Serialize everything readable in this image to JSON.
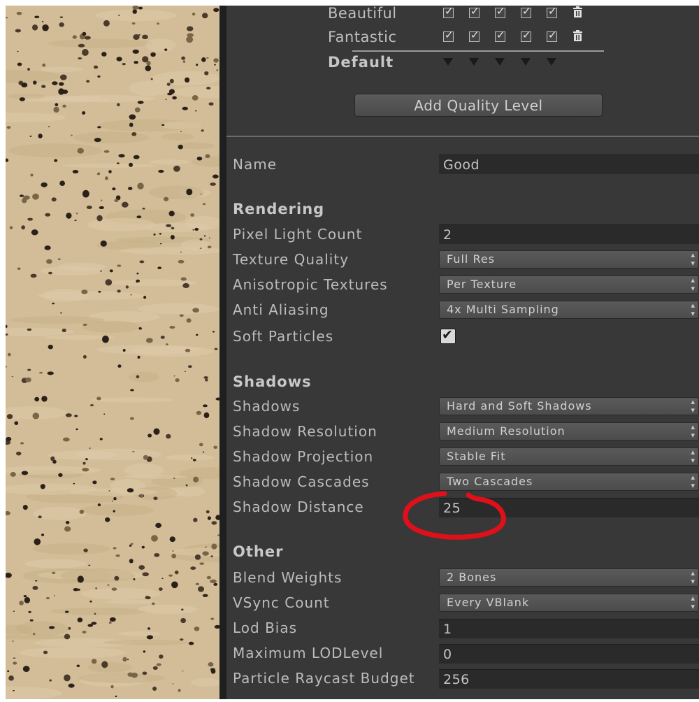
{
  "quality_matrix": {
    "rows": [
      {
        "label": "Beautiful",
        "bold": false,
        "kind": "checks"
      },
      {
        "label": "Fantastic",
        "bold": false,
        "kind": "checks"
      },
      {
        "label": "Default",
        "bold": true,
        "kind": "defaults"
      }
    ],
    "add_button_label": "Add Quality Level"
  },
  "settings": {
    "name_label": "Name",
    "name_value": "Good",
    "rendering": {
      "header": "Rendering",
      "pixel_light_count_label": "Pixel Light Count",
      "pixel_light_count_value": "2",
      "texture_quality_label": "Texture Quality",
      "texture_quality_value": "Full Res",
      "anisotropic_label": "Anisotropic Textures",
      "anisotropic_value": "Per Texture",
      "anti_aliasing_label": "Anti Aliasing",
      "anti_aliasing_value": "4x Multi Sampling",
      "soft_particles_label": "Soft Particles",
      "soft_particles_checked": true
    },
    "shadows": {
      "header": "Shadows",
      "shadows_label": "Shadows",
      "shadows_value": "Hard and Soft Shadows",
      "resolution_label": "Shadow Resolution",
      "resolution_value": "Medium Resolution",
      "projection_label": "Shadow Projection",
      "projection_value": "Stable Fit",
      "cascades_label": "Shadow Cascades",
      "cascades_value": "Two Cascades",
      "distance_label": "Shadow Distance",
      "distance_value": "25"
    },
    "other": {
      "header": "Other",
      "blend_weights_label": "Blend Weights",
      "blend_weights_value": "2 Bones",
      "vsync_label": "VSync Count",
      "vsync_value": "Every VBlank",
      "lod_bias_label": "Lod Bias",
      "lod_bias_value": "1",
      "max_lod_label": "Maximum LODLevel",
      "max_lod_value": "0",
      "raycast_budget_label": "Particle Raycast Budget",
      "raycast_budget_value": "256"
    }
  },
  "colors": {
    "panel_bg": "#383838",
    "field_bg": "#2a2a2a",
    "annotation_red": "#e0101a",
    "sand": "#d2bd98"
  }
}
